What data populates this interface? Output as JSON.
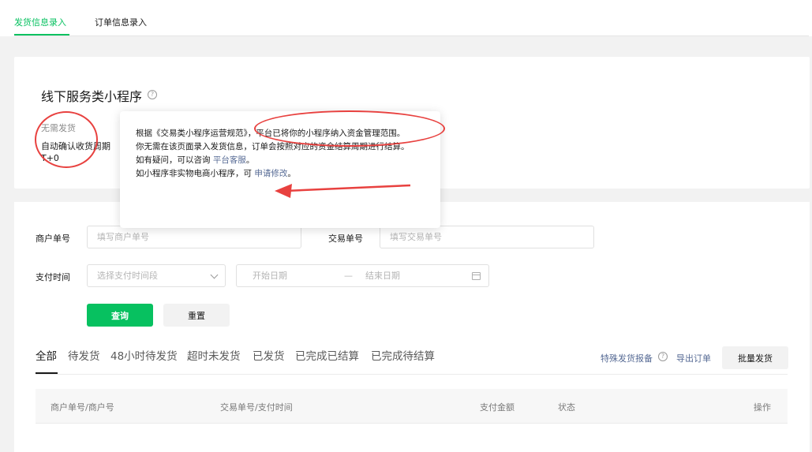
{
  "top_tabs": [
    {
      "label": "发货信息录入",
      "active": true
    },
    {
      "label": "订单信息录入",
      "active": false
    }
  ],
  "info_card": {
    "title": "线下服务类小程序",
    "help_icon": "question-circle-icon",
    "no_ship": "无需发货",
    "auto_confirm": "自动确认收货周期",
    "period": "T+0"
  },
  "popover": {
    "line1": "根据《交易类小程序运营规范》，平台已将你的小程序纳入资金管理范围。",
    "line2": "你无需在该页面录入发货信息，订单会按照对应的资金结算周期进行结算。",
    "line3_prefix": "如有疑问，可以咨询 ",
    "line3_link": "平台客服",
    "line3_suffix": "。",
    "line4_prefix": "如小程序非实物电商小程序，可 ",
    "line4_link": "申请修改",
    "line4_suffix": "。"
  },
  "filters": {
    "merchant_no_label": "商户单号",
    "merchant_no_placeholder": "填写商户单号",
    "trade_no_label": "交易单号",
    "trade_no_placeholder": "填写交易单号",
    "pay_time_label": "支付时间",
    "pay_time_placeholder": "选择支付时间段",
    "start_date_placeholder": "开始日期",
    "date_separator": "—",
    "end_date_placeholder": "结束日期",
    "query_label": "查询",
    "reset_label": "重置"
  },
  "status_tabs": [
    {
      "label": "全部",
      "active": true
    },
    {
      "label": "待发货",
      "active": false
    },
    {
      "label": "48小时待发货",
      "active": false
    },
    {
      "label": "超时未发货",
      "active": false
    },
    {
      "label": "已发货",
      "active": false
    },
    {
      "label": "已完成已结算",
      "active": false
    },
    {
      "label": "已完成待结算",
      "active": false
    }
  ],
  "actions": {
    "special_report": "特殊发货报备",
    "export_orders": "导出订单",
    "batch_ship": "批量发货"
  },
  "table": {
    "columns": [
      "商户单号/商户号",
      "交易单号/支付时间",
      "支付金额",
      "状态",
      "操作"
    ]
  },
  "colors": {
    "brand_green": "#07c160",
    "link_blue": "#576b95",
    "annotation_red": "#e8413f"
  }
}
